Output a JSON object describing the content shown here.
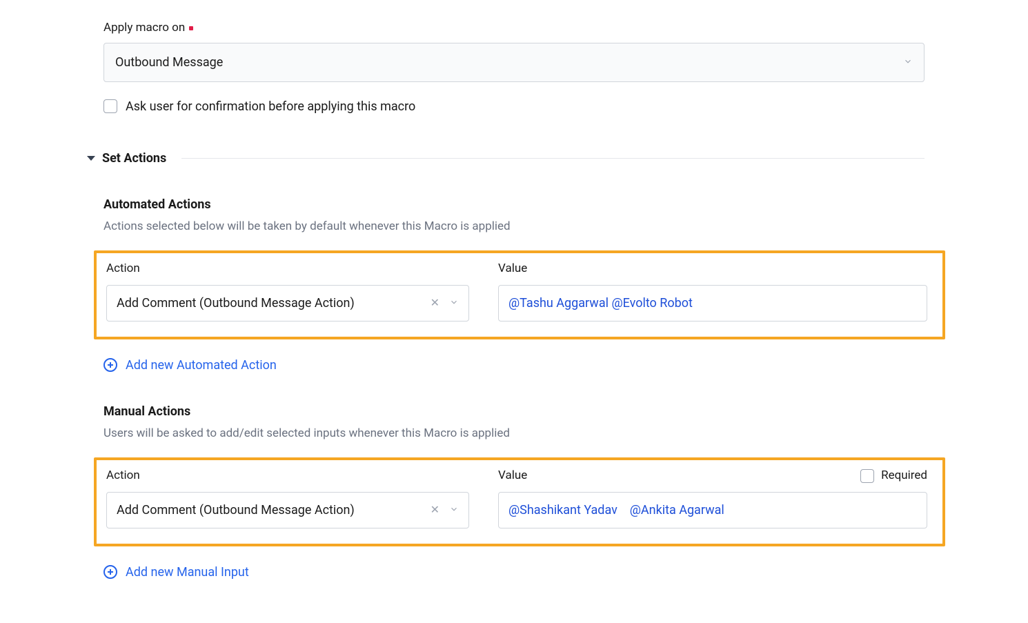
{
  "apply_macro": {
    "label": "Apply macro on",
    "value": "Outbound Message"
  },
  "confirm": {
    "label": "Ask user for confirmation before applying this macro",
    "checked": false
  },
  "section": {
    "title": "Set Actions"
  },
  "automated": {
    "title": "Automated Actions",
    "desc": "Actions selected below will be taken by default whenever this Macro is applied",
    "cols": {
      "action": "Action",
      "value": "Value"
    },
    "row": {
      "action": "Add Comment (Outbound Message Action)",
      "mentions": [
        "@Tashu Aggarwal",
        "@Evolto Robot"
      ]
    },
    "add": "Add new Automated Action"
  },
  "manual": {
    "title": "Manual Actions",
    "desc": "Users will be asked to add/edit selected inputs whenever this Macro is applied",
    "cols": {
      "action": "Action",
      "value": "Value",
      "required": "Required"
    },
    "required_checked": false,
    "row": {
      "action": "Add Comment (Outbound Message Action)",
      "mentions": [
        "@Shashikant Yadav",
        "@Ankita Agarwal"
      ]
    },
    "add": "Add new Manual Input"
  }
}
